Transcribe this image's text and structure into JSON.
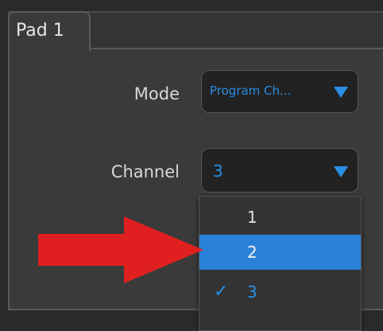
{
  "tab": {
    "label": "Pad 1"
  },
  "fields": {
    "mode": {
      "label": "Mode",
      "value": "Program Ch..."
    },
    "channel": {
      "label": "Channel",
      "value": "3"
    }
  },
  "dropdown": {
    "options": [
      {
        "label": "1",
        "state": "normal"
      },
      {
        "label": "2",
        "state": "highlighted"
      },
      {
        "label": "3",
        "state": "checked"
      }
    ],
    "check_glyph": "✓"
  },
  "colors": {
    "accent": "#2a8fe6",
    "highlight": "#2a82d8",
    "arrow": "#e02020"
  },
  "annotation": {
    "arrow_icon": "red-right-arrow-icon"
  }
}
